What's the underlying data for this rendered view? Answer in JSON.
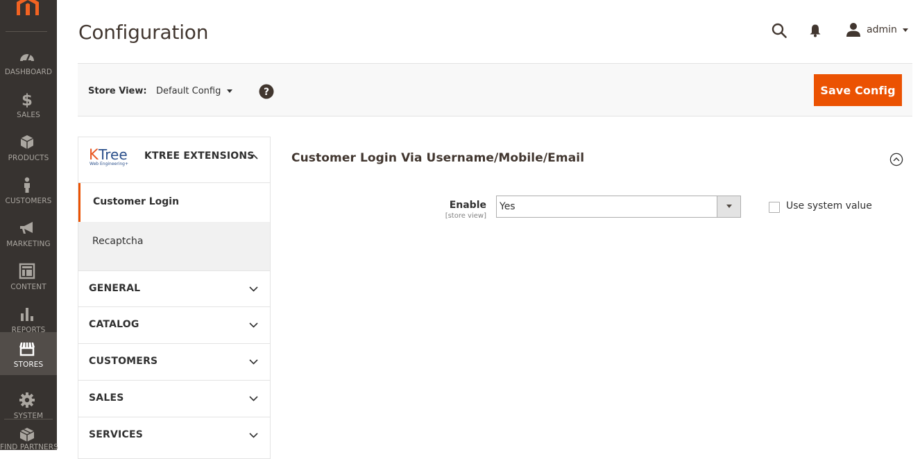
{
  "app": {
    "brand_color": "#eb5202",
    "menu_bg": "#373330"
  },
  "admin_menu": {
    "items": [
      {
        "label": "DASHBOARD",
        "icon": "dashboard-icon",
        "active": false
      },
      {
        "label": "SALES",
        "icon": "dollar-icon",
        "active": false
      },
      {
        "label": "PRODUCTS",
        "icon": "box-icon",
        "active": false
      },
      {
        "label": "CUSTOMERS",
        "icon": "person-icon",
        "active": false
      },
      {
        "label": "MARKETING",
        "icon": "megaphone-icon",
        "active": false
      },
      {
        "label": "CONTENT",
        "icon": "layout-icon",
        "active": false
      },
      {
        "label": "REPORTS",
        "icon": "bar-chart-icon",
        "active": false
      },
      {
        "label": "STORES",
        "icon": "store-icon",
        "active": true
      },
      {
        "label": "SYSTEM",
        "icon": "gear-icon",
        "active": false
      },
      {
        "label": "FIND PARTNERS",
        "icon": "cube-icon",
        "active": false
      }
    ]
  },
  "header": {
    "title": "Configuration",
    "user": "admin"
  },
  "store_bar": {
    "label": "Store View:",
    "value": "Default Config",
    "save_label": "Save Config"
  },
  "tabs": {
    "logo_text": "KTree",
    "logo_sub": "Web Engineering+",
    "group_title": "KTREE EXTENSIONS",
    "sub_items": [
      "Customer Login",
      "Recaptcha"
    ],
    "sections": [
      "GENERAL",
      "CATALOG",
      "CUSTOMERS",
      "SALES",
      "SERVICES"
    ]
  },
  "main": {
    "section_title": "Customer Login Via Username/Mobile/Email",
    "field": {
      "label": "Enable",
      "scope": "[store view]",
      "value": "Yes",
      "system_value_label": "Use system value"
    }
  }
}
